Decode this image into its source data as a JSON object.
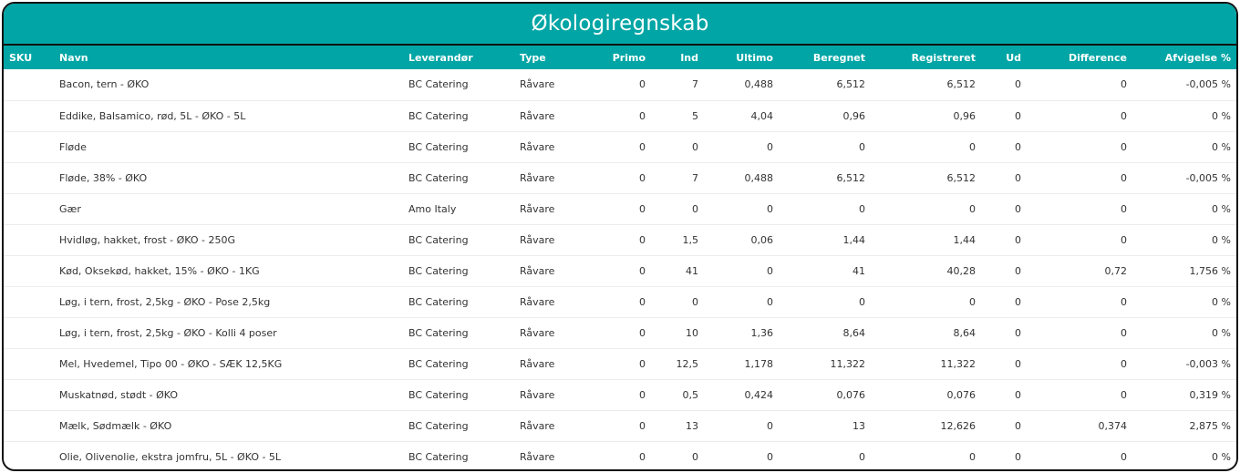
{
  "title": "Økologiregnskab",
  "columns": {
    "sku": "SKU",
    "navn": "Navn",
    "leverandor": "Leverandør",
    "type": "Type",
    "primo": "Primo",
    "ind": "Ind",
    "ultimo": "Ultimo",
    "beregnet": "Beregnet",
    "registreret": "Registreret",
    "ud": "Ud",
    "difference": "Difference",
    "afvigelse": "Afvigelse %"
  },
  "rows": [
    {
      "sku": "",
      "navn": "Bacon, tern - ØKO",
      "leverandor": "BC Catering",
      "type": "Råvare",
      "primo": "0",
      "ind": "7",
      "ultimo": "0,488",
      "beregnet": "6,512",
      "registreret": "6,512",
      "ud": "0",
      "difference": "0",
      "afvigelse": "-0,005 %"
    },
    {
      "sku": "",
      "navn": "Eddike, Balsamico, rød, 5L - ØKO - 5L",
      "leverandor": "BC Catering",
      "type": "Råvare",
      "primo": "0",
      "ind": "5",
      "ultimo": "4,04",
      "beregnet": "0,96",
      "registreret": "0,96",
      "ud": "0",
      "difference": "0",
      "afvigelse": "0 %"
    },
    {
      "sku": "",
      "navn": "Fløde",
      "leverandor": "BC Catering",
      "type": "Råvare",
      "primo": "0",
      "ind": "0",
      "ultimo": "0",
      "beregnet": "0",
      "registreret": "0",
      "ud": "0",
      "difference": "0",
      "afvigelse": "0 %"
    },
    {
      "sku": "",
      "navn": "Fløde, 38% - ØKO",
      "leverandor": "BC Catering",
      "type": "Råvare",
      "primo": "0",
      "ind": "7",
      "ultimo": "0,488",
      "beregnet": "6,512",
      "registreret": "6,512",
      "ud": "0",
      "difference": "0",
      "afvigelse": "-0,005 %"
    },
    {
      "sku": "",
      "navn": "Gær",
      "leverandor": "Amo Italy",
      "type": "Råvare",
      "primo": "0",
      "ind": "0",
      "ultimo": "0",
      "beregnet": "0",
      "registreret": "0",
      "ud": "0",
      "difference": "0",
      "afvigelse": "0 %"
    },
    {
      "sku": "",
      "navn": "Hvidløg, hakket, frost - ØKO - 250G",
      "leverandor": "BC Catering",
      "type": "Råvare",
      "primo": "0",
      "ind": "1,5",
      "ultimo": "0,06",
      "beregnet": "1,44",
      "registreret": "1,44",
      "ud": "0",
      "difference": "0",
      "afvigelse": "0 %"
    },
    {
      "sku": "",
      "navn": "Kød, Oksekød, hakket, 15% - ØKO - 1KG",
      "leverandor": "BC Catering",
      "type": "Råvare",
      "primo": "0",
      "ind": "41",
      "ultimo": "0",
      "beregnet": "41",
      "registreret": "40,28",
      "ud": "0",
      "difference": "0,72",
      "afvigelse": "1,756 %"
    },
    {
      "sku": "",
      "navn": "Løg, i tern, frost, 2,5kg - ØKO - Pose 2,5kg",
      "leverandor": "BC Catering",
      "type": "Råvare",
      "primo": "0",
      "ind": "0",
      "ultimo": "0",
      "beregnet": "0",
      "registreret": "0",
      "ud": "0",
      "difference": "0",
      "afvigelse": "0 %"
    },
    {
      "sku": "",
      "navn": "Løg, i tern, frost, 2,5kg - ØKO - Kolli 4 poser",
      "leverandor": "BC Catering",
      "type": "Råvare",
      "primo": "0",
      "ind": "10",
      "ultimo": "1,36",
      "beregnet": "8,64",
      "registreret": "8,64",
      "ud": "0",
      "difference": "0",
      "afvigelse": "0 %"
    },
    {
      "sku": "",
      "navn": "Mel, Hvedemel, Tipo 00 - ØKO - SÆK 12,5KG",
      "leverandor": "BC Catering",
      "type": "Råvare",
      "primo": "0",
      "ind": "12,5",
      "ultimo": "1,178",
      "beregnet": "11,322",
      "registreret": "11,322",
      "ud": "0",
      "difference": "0",
      "afvigelse": "-0,003 %"
    },
    {
      "sku": "",
      "navn": "Muskatnød, stødt - ØKO",
      "leverandor": "BC Catering",
      "type": "Råvare",
      "primo": "0",
      "ind": "0,5",
      "ultimo": "0,424",
      "beregnet": "0,076",
      "registreret": "0,076",
      "ud": "0",
      "difference": "0",
      "afvigelse": "0,319 %"
    },
    {
      "sku": "",
      "navn": "Mælk, Sødmælk - ØKO",
      "leverandor": "BC Catering",
      "type": "Råvare",
      "primo": "0",
      "ind": "13",
      "ultimo": "0",
      "beregnet": "13",
      "registreret": "12,626",
      "ud": "0",
      "difference": "0,374",
      "afvigelse": "2,875 %"
    },
    {
      "sku": "",
      "navn": "Olie, Olivenolie, ekstra jomfru, 5L - ØKO - 5L",
      "leverandor": "BC Catering",
      "type": "Råvare",
      "primo": "0",
      "ind": "0",
      "ultimo": "0",
      "beregnet": "0",
      "registreret": "0",
      "ud": "0",
      "difference": "0",
      "afvigelse": "0 %"
    }
  ]
}
